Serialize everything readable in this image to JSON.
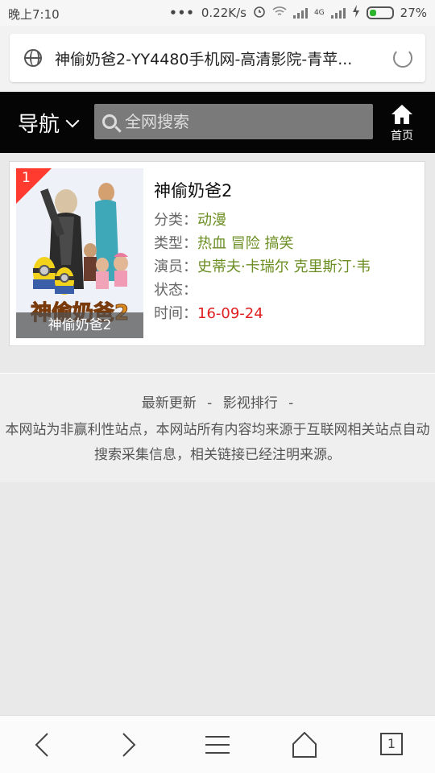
{
  "status": {
    "time": "晚上7:10",
    "dots": "•••",
    "speed": "0.22K/s",
    "net_label": "4G",
    "battery": "27%"
  },
  "address_bar": {
    "title": "神偷奶爸2-YY4480手机网-高清影院-青苹..."
  },
  "topnav": {
    "nav_label": "导航",
    "search_placeholder": "全网搜索",
    "home_label": "首页"
  },
  "movie": {
    "rank": "1",
    "poster_caption": "神偷奶爸2",
    "title": "神偷奶爸2",
    "category_label": "分类：",
    "category": "动漫",
    "genre_label": "类型：",
    "genres": "热血 冒险 搞笑",
    "actors_label": "演员：",
    "actors": "史蒂夫·卡瑞尔 克里斯汀·韦",
    "status_label": "状态：",
    "status": "",
    "time_label": "时间：",
    "time": "16-09-24"
  },
  "footer": {
    "link_latest": "最新更新",
    "sep1": "-",
    "link_ranking": "影视排行",
    "sep2": "-",
    "note": "本网站为非赢利性站点，本网站所有内容均来源于互联网相关站点自动搜索采集信息，相关链接已经注明来源。"
  },
  "toolbar": {
    "tab_count": "1"
  },
  "colors": {
    "nav_bg": "#050505",
    "search_bg": "#7a7a7a",
    "value_green": "#6b8e23",
    "time_red": "#e02020",
    "rank_red": "#ff3b30"
  }
}
